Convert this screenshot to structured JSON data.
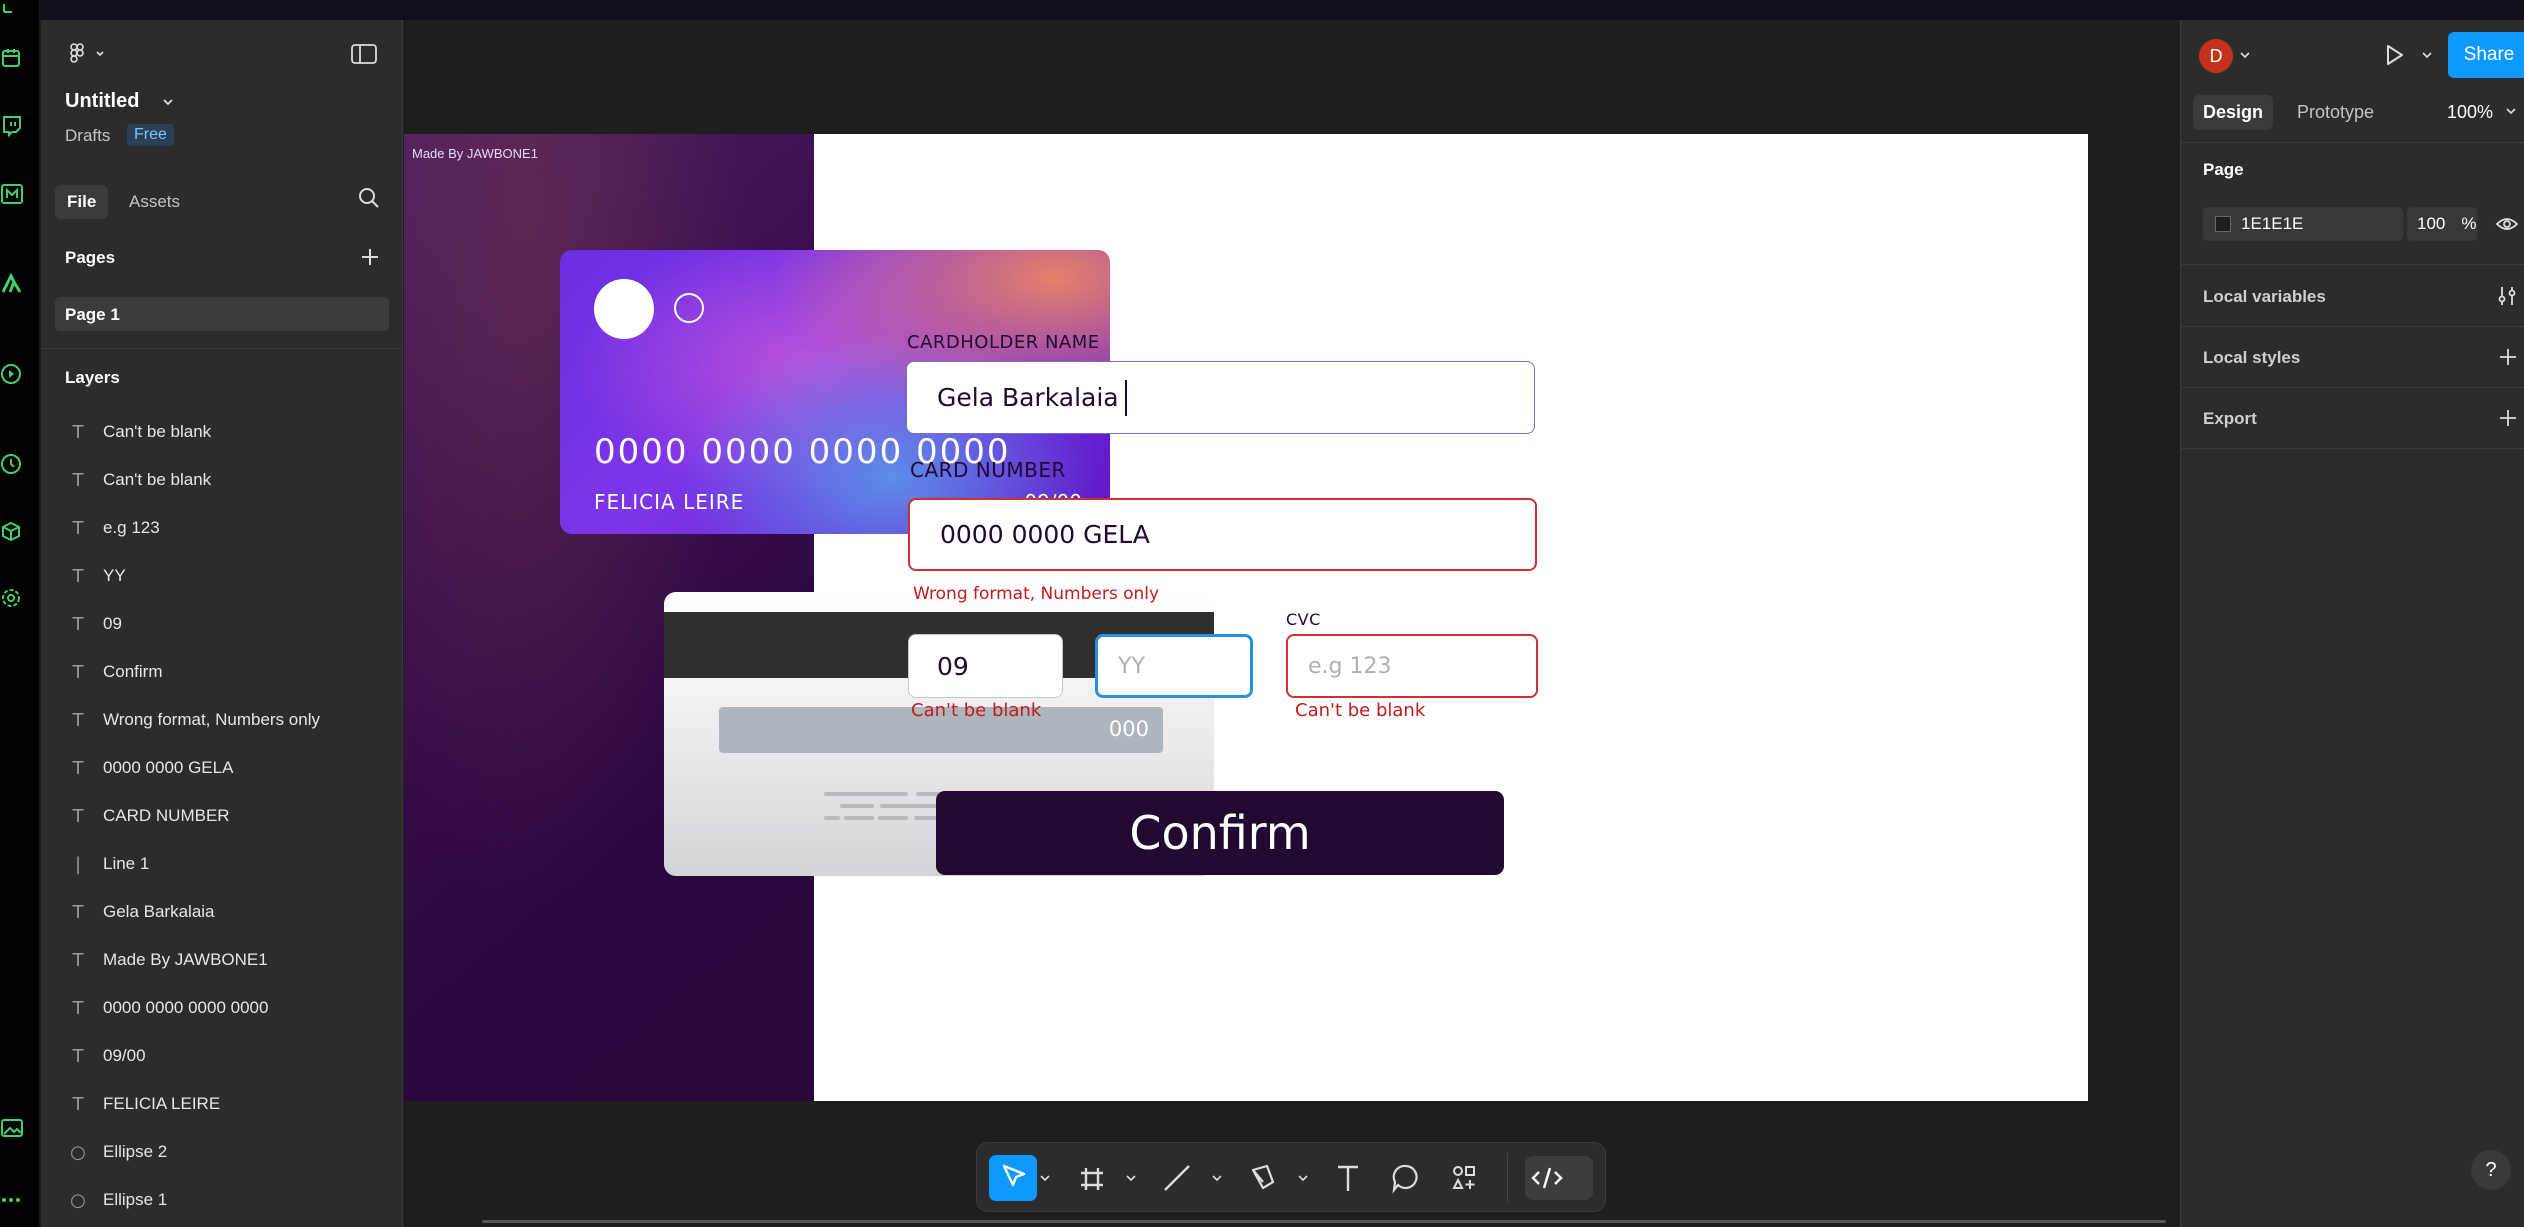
{
  "app": {
    "file_name": "Untitled",
    "drafts": "Drafts",
    "plan_badge": "Free",
    "tabs": {
      "file": "File",
      "assets": "Assets"
    },
    "pages_title": "Pages",
    "current_page": "Page 1",
    "layers_title": "Layers"
  },
  "layers": [
    {
      "icon": "text-icon",
      "label": "Can't be blank"
    },
    {
      "icon": "text-icon",
      "label": "Can't be blank"
    },
    {
      "icon": "text-icon",
      "label": "e.g 123"
    },
    {
      "icon": "text-icon",
      "label": "YY"
    },
    {
      "icon": "text-icon",
      "label": "09"
    },
    {
      "icon": "text-icon",
      "label": "Confirm"
    },
    {
      "icon": "text-icon",
      "label": "Wrong format, Numbers only"
    },
    {
      "icon": "text-icon",
      "label": "0000 0000 GELA"
    },
    {
      "icon": "text-icon",
      "label": "CARD NUMBER"
    },
    {
      "icon": "line-icon",
      "label": "Line 1"
    },
    {
      "icon": "text-icon",
      "label": "Gela Barkalaia"
    },
    {
      "icon": "text-icon",
      "label": "Made By JAWBONE1"
    },
    {
      "icon": "text-icon",
      "label": "0000 0000 0000 0000"
    },
    {
      "icon": "text-icon",
      "label": "09/00"
    },
    {
      "icon": "text-icon",
      "label": "FELICIA LEIRE"
    },
    {
      "icon": "ellipse-icon",
      "label": "Ellipse 2"
    },
    {
      "icon": "ellipse-icon",
      "label": "Ellipse 1"
    }
  ],
  "design": {
    "made_by": "Made By JAWBONE1",
    "card_front": {
      "number": "0000 0000 0000 0000",
      "name": "FELICIA LEIRE",
      "expiry": "09/00"
    },
    "card_back": {
      "cvc": "000"
    },
    "cardholder_label": "CARDHOLDER NAME",
    "cardholder_value": "Gela Barkalaia",
    "card_number_label": "CARD NUMBER",
    "card_number_value": "0000 0000 GELA",
    "card_number_error": "Wrong format, Numbers only",
    "month_value": "09",
    "year_placeholder": "YY",
    "cvc_label": "CVC",
    "cvc_placeholder": "e.g 123",
    "month_error": "Can't be blank",
    "cvc_error": "Can't be blank",
    "confirm_label": "Confirm"
  },
  "right_panel": {
    "avatar_initial": "D",
    "share_label": "Share",
    "tabs": {
      "design": "Design",
      "prototype": "Prototype"
    },
    "zoom": "100%",
    "page_section": "Page",
    "page_color": "1E1E1E",
    "page_opacity": "100",
    "opacity_unit": "%",
    "local_variables": "Local variables",
    "local_styles": "Local styles",
    "export": "Export",
    "help": "?"
  },
  "colors": {
    "accent": "#0d99ff",
    "canvas_bg": "#1e1e1e",
    "panel_bg": "#2c2c2c",
    "rail_icon": "#3fd16a",
    "error": "#c41a1a",
    "dark_violet": "#21092f"
  }
}
